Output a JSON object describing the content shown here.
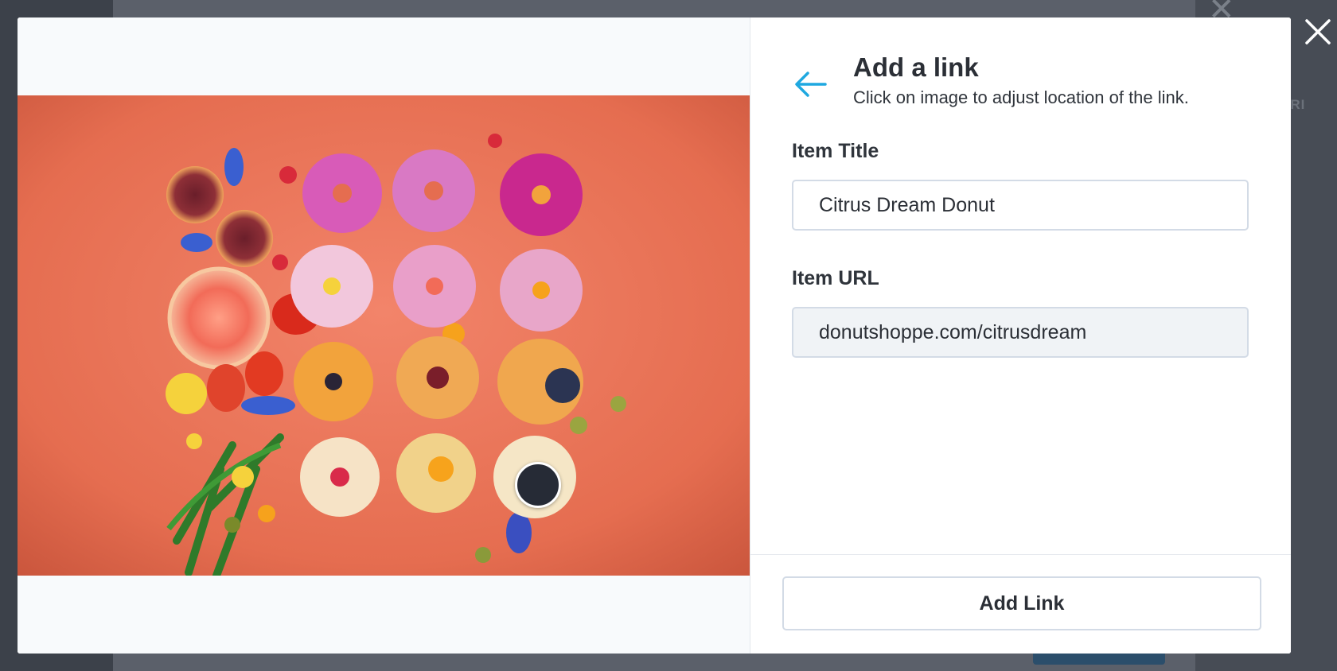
{
  "modal": {
    "title": "Add a link",
    "subtitle": "Click on image to adjust location of the link.",
    "item_title_label": "Item Title",
    "item_title_value": "Citrus Dream Donut",
    "item_url_label": "Item URL",
    "item_url_value": "donutshoppe.com/citrusdream",
    "add_button_label": "Add Link"
  },
  "background": {
    "partial_label": "FRI"
  },
  "icons": {
    "back": "arrow-left-icon",
    "close": "close-icon"
  },
  "colors": {
    "accent": "#1fa8e0",
    "marker": "#262b36",
    "photo_background": "#ea7356"
  }
}
